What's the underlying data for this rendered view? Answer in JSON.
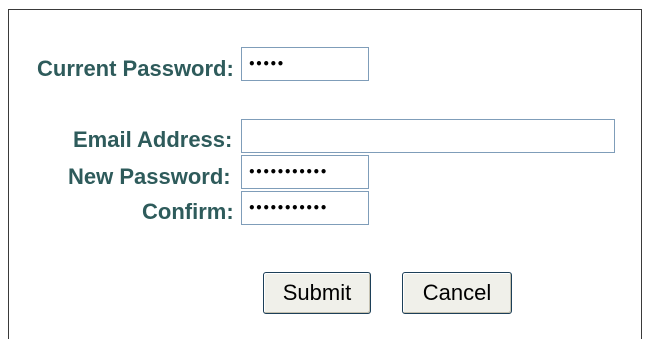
{
  "form": {
    "current_password": {
      "label": "Current Password:",
      "masked_value": "•••••"
    },
    "email": {
      "label": "Email Address:",
      "value": ""
    },
    "new_password": {
      "label": "New Password:",
      "masked_value": "•••••••••••"
    },
    "confirm": {
      "label": "Confirm:",
      "masked_value": "•••••••••••"
    }
  },
  "buttons": {
    "submit": "Submit",
    "cancel": "Cancel"
  }
}
